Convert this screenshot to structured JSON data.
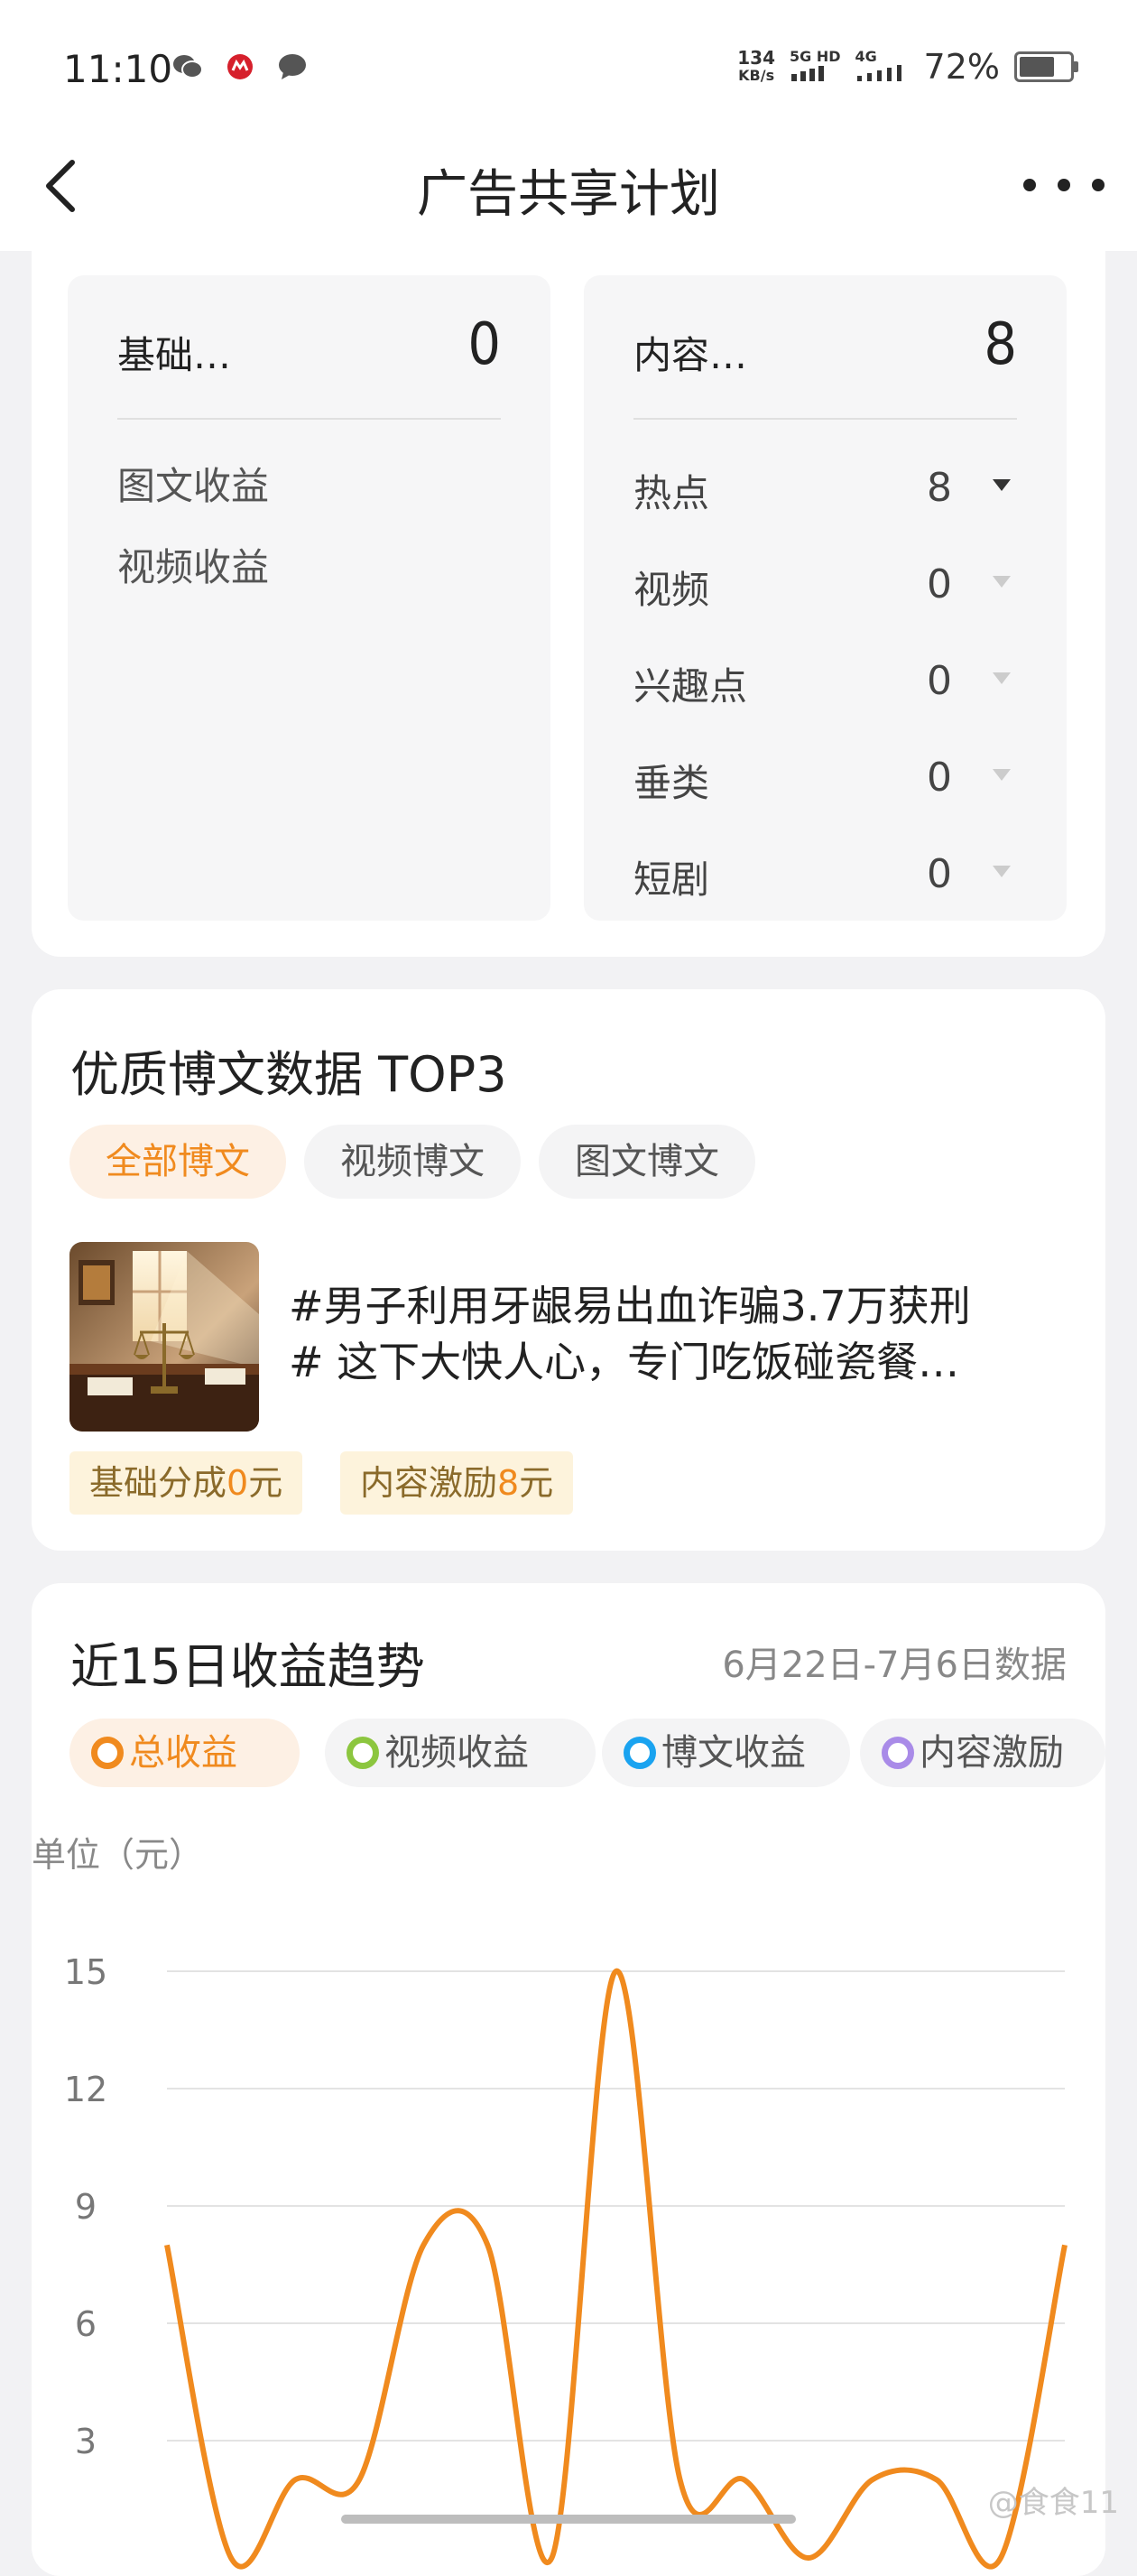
{
  "status_bar": {
    "time": "11:10",
    "speed_value": "134",
    "speed_unit": "KB/s",
    "network1": "5G HD",
    "network2": "4G",
    "battery": "72%"
  },
  "navbar": {
    "title": "广告共享计划"
  },
  "earnings_breakdown": {
    "basic": {
      "title": "基础…",
      "value": "0",
      "items": [
        "图文收益",
        "视频收益"
      ]
    },
    "content": {
      "title": "内容…",
      "value": "8",
      "items": [
        {
          "label": "热点",
          "value": "8",
          "active": true
        },
        {
          "label": "视频",
          "value": "0",
          "active": false
        },
        {
          "label": "兴趣点",
          "value": "0",
          "active": false
        },
        {
          "label": "垂类",
          "value": "0",
          "active": false
        },
        {
          "label": "短剧",
          "value": "0",
          "active": false
        }
      ]
    }
  },
  "top_posts": {
    "title": "优质博文数据 TOP3",
    "tabs": [
      "全部博文",
      "视频博文",
      "图文博文"
    ],
    "active_tab": "全部博文",
    "post": {
      "line1": "#男子利用牙龈易出血诈骗3.7万获刑",
      "line2": "# 这下大快人心，专门吃饭碰瓷餐…",
      "tag1_prefix": "基础分成",
      "tag1_value": "0",
      "tag1_suffix": "元",
      "tag2_prefix": "内容激励",
      "tag2_value": "8",
      "tag2_suffix": "元"
    }
  },
  "trend": {
    "title": "近15日收益趋势",
    "date_range": "6月22日-7月6日数据",
    "legend": [
      {
        "label": "总收益",
        "color": "#f08a1e",
        "active": true
      },
      {
        "label": "视频收益",
        "color": "#8cc63f",
        "active": false
      },
      {
        "label": "博文收益",
        "color": "#1aa3f0",
        "active": false
      },
      {
        "label": "内容激励",
        "color": "#a98be8",
        "active": false
      }
    ],
    "unit": "单位（元）"
  },
  "chart_data": {
    "type": "line",
    "series": [
      {
        "name": "总收益",
        "color": "#f08a1e",
        "values": [
          8,
          0,
          2,
          2,
          8,
          8,
          0,
          15,
          2,
          2,
          0,
          2,
          2,
          0,
          8
        ]
      }
    ],
    "x": [
      1,
      2,
      3,
      4,
      5,
      6,
      7,
      8,
      9,
      10,
      11,
      12,
      13,
      14,
      15
    ],
    "yticks": [
      3,
      6,
      9,
      12,
      15
    ],
    "ylim": [
      0,
      15
    ],
    "grid": true
  },
  "watermark": "@食食11"
}
